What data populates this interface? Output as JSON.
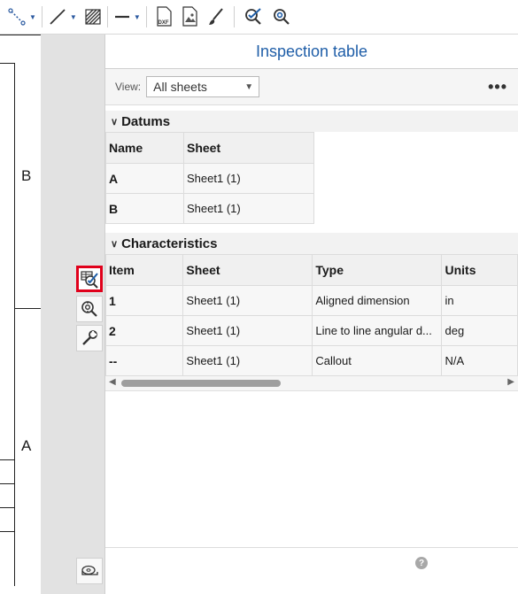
{
  "toolbar": {
    "tools": [
      {
        "icon": "sketch-line-icon",
        "dropdown": true
      },
      {
        "icon": "line-tool-icon",
        "dropdown": true
      },
      {
        "icon": "hatch-icon"
      },
      {
        "icon": "line-style-icon",
        "dropdown": true
      },
      {
        "icon": "dxf-export-icon",
        "badge": "DXF"
      },
      {
        "icon": "insert-image-icon"
      },
      {
        "icon": "brush-icon"
      },
      {
        "icon": "inspection-icon"
      },
      {
        "icon": "inspection-settings-icon"
      }
    ]
  },
  "drawing": {
    "zone_b": "B",
    "zone_a": "A"
  },
  "panel": {
    "title": "Inspection table",
    "view_label": "View:",
    "view_value": "All sheets",
    "more_label": "•••",
    "datums": {
      "title": "Datums",
      "headers": [
        "Name",
        "Sheet"
      ],
      "rows": [
        [
          "A",
          "Sheet1 (1)"
        ],
        [
          "B",
          "Sheet1 (1)"
        ]
      ]
    },
    "characteristics": {
      "title": "Characteristics",
      "headers": [
        "Item",
        "Sheet",
        "Type",
        "Units"
      ],
      "rows": [
        [
          "1",
          "Sheet1 (1)",
          "Aligned dimension",
          "in"
        ],
        [
          "2",
          "Sheet1 (1)",
          "Line to line angular d...",
          "deg"
        ],
        [
          "--",
          "Sheet1 (1)",
          "Callout",
          "N/A"
        ]
      ]
    },
    "help_label": "?"
  },
  "colors": {
    "accent": "#1f5ea8",
    "highlight": "#e0001b"
  }
}
